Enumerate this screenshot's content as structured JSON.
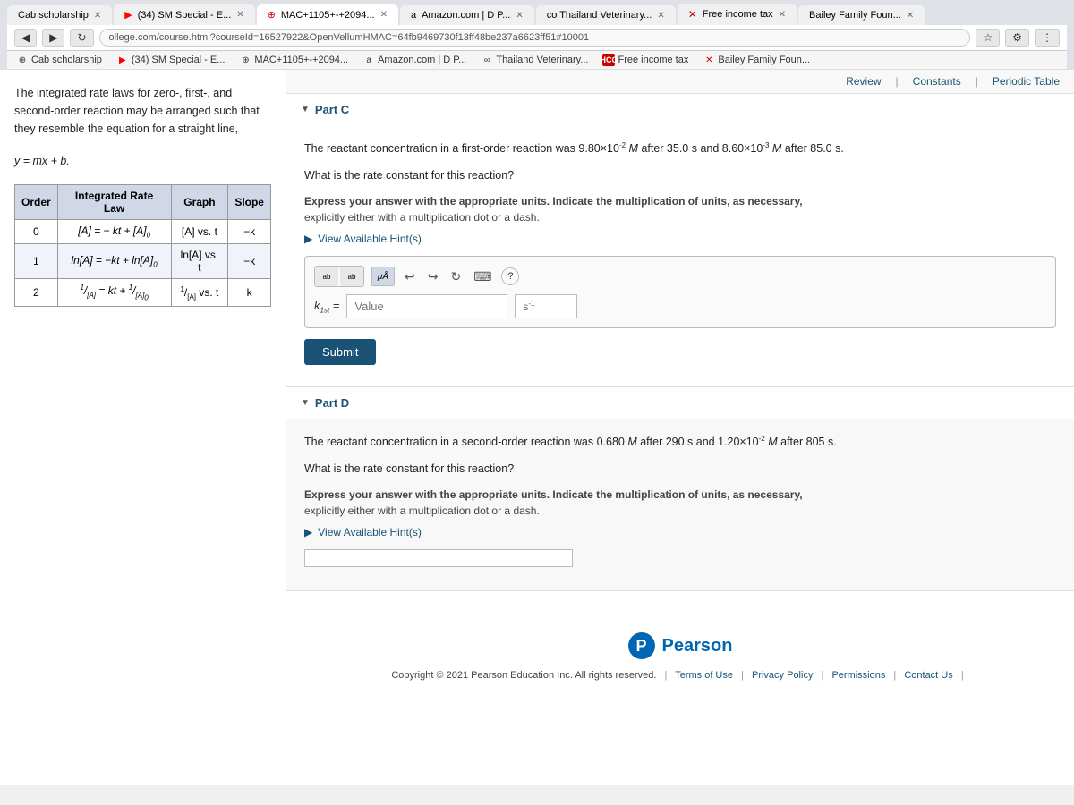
{
  "browser": {
    "url": "ollege.com/course.html?courseId=16527922&OpenVellumHMAC=64fb9469730f13ff48be237a6623ff51#10001",
    "tabs": [
      {
        "label": "Cab scholarship",
        "active": false
      },
      {
        "label": "(34) SM Special - E...",
        "active": false
      },
      {
        "label": "MAC+1105+-+2094...",
        "active": false
      },
      {
        "label": "Amazon.com | D P...",
        "active": false
      },
      {
        "label": "co Thailand Veterinary...",
        "active": false
      },
      {
        "label": "Free income tax",
        "active": false
      },
      {
        "label": "Bailey Family Foun...",
        "active": false
      }
    ]
  },
  "topbar": {
    "review_label": "Review",
    "constants_label": "Constants",
    "periodic_table_label": "Periodic Table",
    "separator": "|"
  },
  "left_panel": {
    "intro": "The integrated rate laws for zero-, first-, and second-order reaction may be arranged such that they resemble the equation for a straight line,",
    "equation": "y = mx + b.",
    "table": {
      "headers": [
        "Order",
        "Integrated Rate Law",
        "Graph",
        "Slope"
      ],
      "rows": [
        {
          "order": "0",
          "law": "[A] = − kt + [A]₀",
          "graph": "[A] vs. t",
          "slope": "−k"
        },
        {
          "order": "1",
          "law": "ln[A] = −kt + ln[A]₀",
          "graph": "ln[A] vs. t",
          "slope": "−k"
        },
        {
          "order": "2",
          "law": "1/[A] = kt + 1/[A]₀",
          "graph": "1/[A] vs. t",
          "slope": "k"
        }
      ]
    }
  },
  "part_c": {
    "header": "Part C",
    "question": "The reactant concentration in a first-order reaction was 9.80×10⁻² M after 35.0 s and 8.60×10⁻³ M after 85.0 s.",
    "sub_question": "What is the rate constant for this reaction?",
    "instruction": "Express your answer with the appropriate units. Indicate the multiplication of units, as necessary, explicitly either with a multiplication dot or a dash.",
    "hint_label": "▶ View Available Hint(s)",
    "k_label": "k₁st =",
    "k_placeholder": "Value",
    "k_unit": "s⁻¹",
    "submit_label": "Submit"
  },
  "part_d": {
    "header": "Part D",
    "question": "The reactant concentration in a second-order reaction was 0.680 M after 290 s and 1.20×10⁻² M after 805 s.",
    "sub_question": "What is the rate constant for this reaction?",
    "instruction": "Express your answer with the appropriate units. Indicate the multiplication of units, as necessary, explicitly either with a multiplication dot or a dash.",
    "hint_label": "▶ View Available Hint(s)"
  },
  "footer": {
    "pearson_label": "Pearson",
    "copyright": "Copyright © 2021 Pearson Education Inc. All rights reserved.",
    "links": [
      "Terms of Use",
      "Privacy Policy",
      "Permissions",
      "Contact Us"
    ]
  }
}
